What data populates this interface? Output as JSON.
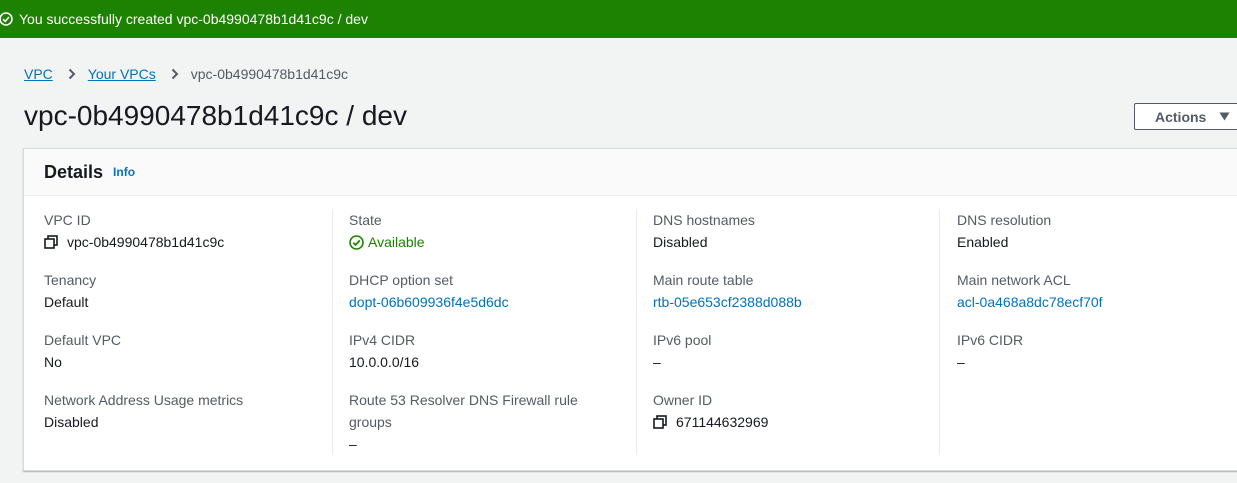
{
  "flash": {
    "message": "You successfully created vpc-0b4990478b1d41c9c / dev"
  },
  "breadcrumb": {
    "items": [
      "VPC",
      "Your VPCs"
    ],
    "current": "vpc-0b4990478b1d41c9c"
  },
  "page": {
    "title": "vpc-0b4990478b1d41c9c / dev",
    "actions_label": "Actions"
  },
  "details": {
    "title": "Details",
    "info_label": "Info",
    "vpc_id": {
      "label": "VPC ID",
      "value": "vpc-0b4990478b1d41c9c"
    },
    "state": {
      "label": "State",
      "value": "Available"
    },
    "dns_hostnames": {
      "label": "DNS hostnames",
      "value": "Disabled"
    },
    "dns_resolution": {
      "label": "DNS resolution",
      "value": "Enabled"
    },
    "tenancy": {
      "label": "Tenancy",
      "value": "Default"
    },
    "dhcp_option_set": {
      "label": "DHCP option set",
      "value": "dopt-06b609936f4e5d6dc"
    },
    "main_route_table": {
      "label": "Main route table",
      "value": "rtb-05e653cf2388d088b"
    },
    "main_network_acl": {
      "label": "Main network ACL",
      "value": "acl-0a468a8dc78ecf70f"
    },
    "default_vpc": {
      "label": "Default VPC",
      "value": "No"
    },
    "ipv4_cidr": {
      "label": "IPv4 CIDR",
      "value": "10.0.0.0/16"
    },
    "ipv6_pool": {
      "label": "IPv6 pool",
      "value": "–"
    },
    "ipv6_cidr": {
      "label": "IPv6 CIDR",
      "value": "–"
    },
    "network_address_usage": {
      "label": "Network Address Usage metrics",
      "value": "Disabled"
    },
    "route53_resolver": {
      "label": "Route 53 Resolver DNS Firewall rule groups",
      "value": "–"
    },
    "owner_id": {
      "label": "Owner ID",
      "value": "671144632969"
    }
  },
  "colors": {
    "success": "#1d8102",
    "link": "#0073bb",
    "text": "#16191f",
    "muted": "#545b64"
  }
}
